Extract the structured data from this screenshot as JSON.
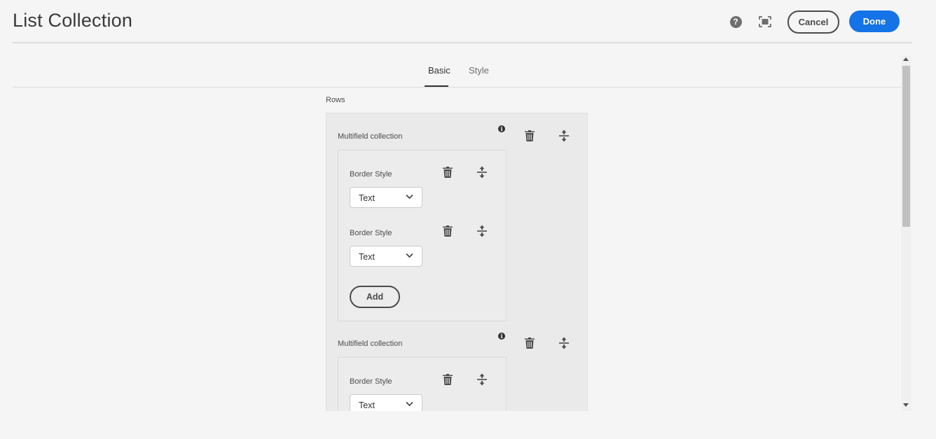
{
  "header": {
    "title": "List Collection",
    "help_icon": "help-icon",
    "fullscreen_icon": "fullscreen-icon",
    "cancel_label": "Cancel",
    "done_label": "Done",
    "done_color": "#1473e6"
  },
  "tabs": [
    {
      "label": "Basic",
      "active": true
    },
    {
      "label": "Style",
      "active": false
    }
  ],
  "form": {
    "rows_label": "Rows",
    "collections": [
      {
        "label": "Multifield collection",
        "items": [
          {
            "label": "Border Style",
            "value": "Text"
          },
          {
            "label": "Border Style",
            "value": "Text"
          }
        ],
        "add_label": "Add"
      },
      {
        "label": "Multifield collection",
        "items": [
          {
            "label": "Border Style",
            "value": "Text"
          }
        ]
      }
    ]
  }
}
